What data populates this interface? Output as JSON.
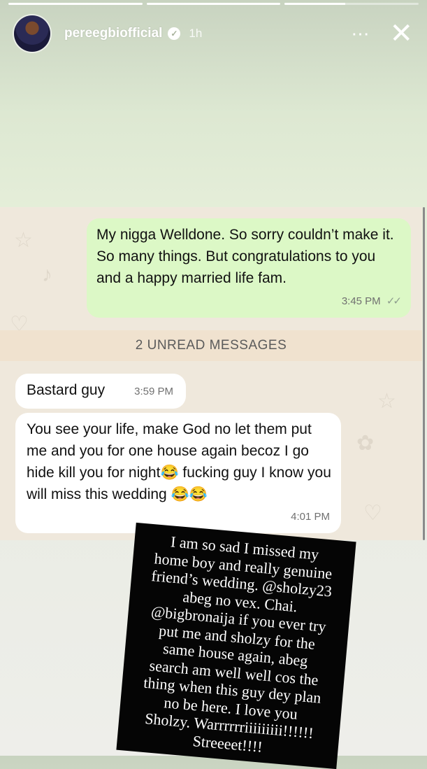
{
  "story": {
    "progress": [
      1.0,
      1.0,
      0.45
    ],
    "username": "pereegbiofficial",
    "time": "1h",
    "more_icon": "⋯",
    "close_icon": "✕"
  },
  "chat": {
    "outgoing": {
      "text": "My nigga Welldone.  So sorry couldn’t make it. So many things. But congratulations to you and a happy married life fam.",
      "time": "3:45 PM",
      "ticks": "✓✓"
    },
    "unread_banner": "2 UNREAD MESSAGES",
    "incoming": [
      {
        "text": "Bastard guy",
        "time": "3:59 PM"
      },
      {
        "text": "You see your life, make God no let them put me and you for one house again becoz I go hide kill you for night😂 fucking guy I know you will miss this wedding 😂😂",
        "time": "4:01 PM"
      }
    ]
  },
  "note": {
    "lines": [
      "I am so sad I missed my",
      "home boy and really genuine",
      "friend’s wedding. @sholzy23",
      "abeg no vex.  Chai.",
      "@bigbronaija if you ever try",
      "put me and sholzy for the",
      "same house again, abeg",
      "search am well well cos the",
      "thing when this guy dey plan",
      "no be here.  I love you",
      "Sholzy.  Warrrrrriiiiiiiii!!!!!!",
      "Streeeet!!!!"
    ]
  },
  "colors": {
    "outgoing_bubble": "#dcf8c6",
    "incoming_bubble": "#ffffff",
    "chat_bg": "#efe8dc",
    "note_bg": "#050505"
  }
}
